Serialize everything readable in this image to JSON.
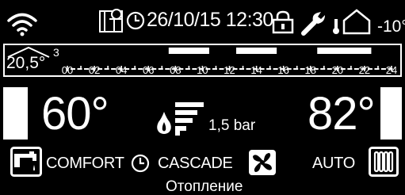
{
  "status_bar": {
    "datetime": "26/10/15 12:30",
    "outdoor_temp": "-10°",
    "icons": [
      "wifi-icon",
      "solar-panel-icon",
      "clock-icon",
      "lock-icon",
      "wrench-icon",
      "outdoor-sensor-icon"
    ]
  },
  "timeline": {
    "room_temp": "20,5°",
    "room_temp_sup": "3",
    "hours": [
      "00",
      "02",
      "04",
      "06",
      "08",
      "10",
      "12",
      "14",
      "16",
      "18",
      "20",
      "22",
      "24"
    ],
    "active_periods": [
      {
        "start": 7.5,
        "end": 10.5
      },
      {
        "start": 12.5,
        "end": 15.5
      },
      {
        "start": 18.5,
        "end": 22.5
      }
    ]
  },
  "main": {
    "flow_temp": "60°",
    "pressure": "1,5 bar",
    "return_temp": "82°",
    "flame_level": 4
  },
  "modes": {
    "comfort": "COMFORT",
    "cascade": "CASCADE",
    "auto": "AUTO"
  },
  "status_text": "Отопление",
  "colors": {
    "background": "#000000",
    "foreground": "#ffffff"
  }
}
